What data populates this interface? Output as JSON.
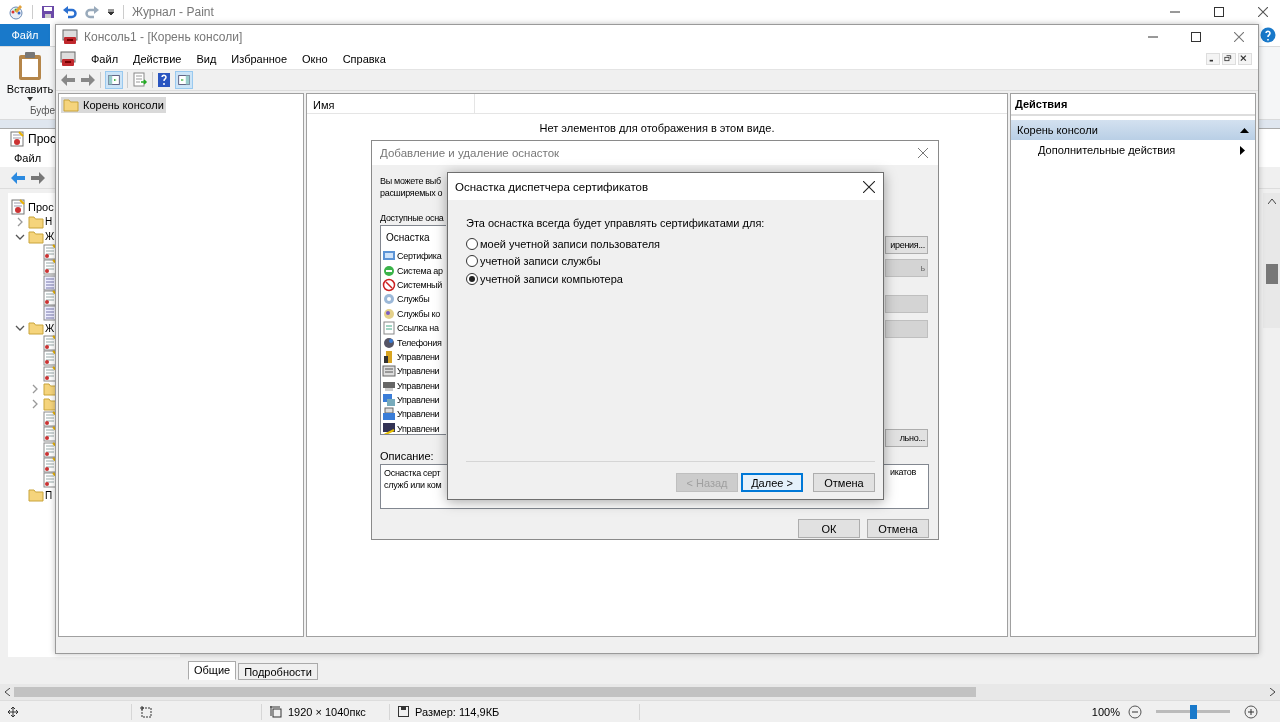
{
  "paint": {
    "title": "Журнал - Paint",
    "ribbon_tab": "Файл",
    "paste_label": "Вставить",
    "group_label": "Буфе",
    "status_bar": {
      "dimensions": "1920 × 1040пкс",
      "file_size": "Размер: 114,9КБ",
      "zoom": "100%",
      "zoom_slider": {
        "level": 0.5
      }
    }
  },
  "event_viewer": {
    "title": "Прос",
    "menu": [
      "Файл"
    ],
    "tree": [
      {
        "label": "Прос",
        "kind": "viewer",
        "children": [
          {
            "label": "Н",
            "kind": "folder",
            "expanded": false
          },
          {
            "label": "Ж",
            "kind": "folder",
            "expanded": true,
            "children": [
              {
                "kind": "log"
              },
              {
                "kind": "log"
              },
              {
                "kind": "list"
              },
              {
                "kind": "log"
              },
              {
                "kind": "list"
              }
            ]
          },
          {
            "label": "Ж",
            "kind": "folder",
            "expanded": true,
            "children": [
              {
                "kind": "log"
              },
              {
                "kind": "log"
              },
              {
                "kind": "log"
              },
              {
                "kind": "folder",
                "expanded": false
              },
              {
                "kind": "folder",
                "expanded": false
              },
              {
                "kind": "log"
              },
              {
                "kind": "log"
              },
              {
                "kind": "log"
              },
              {
                "kind": "log"
              },
              {
                "kind": "log"
              }
            ]
          },
          {
            "label": "П",
            "kind": "folder"
          }
        ]
      }
    ],
    "tabs": [
      {
        "label": "Общие",
        "selected": true
      },
      {
        "label": "Подробности",
        "selected": false
      }
    ]
  },
  "mmc": {
    "title": "Консоль1 - [Корень консоли]",
    "menu": [
      "Файл",
      "Действие",
      "Вид",
      "Избранное",
      "Окно",
      "Справка"
    ],
    "toolbar_toggles": {
      "console_tree": true,
      "action_pane": true
    },
    "tree": [
      {
        "label": "Корень консоли",
        "selected": true
      }
    ],
    "columns": [
      "Имя"
    ],
    "empty_message": "Нет элементов для отображения в этом виде.",
    "actions": {
      "title": "Действия",
      "groups": [
        {
          "label": "Корень консоли",
          "expanded": true,
          "items": [
            {
              "label": "Дополнительные действия",
              "submenu": true
            }
          ]
        }
      ]
    }
  },
  "add_dialog": {
    "title": "Добавление и удаление оснасток",
    "intro": [
      "Вы можете выб",
      "расширяемых о"
    ],
    "available_label": "Доступные осна",
    "list_header": "Оснастка",
    "snapins": [
      "Сертифика",
      "Система ар",
      "Системный",
      "Службы",
      "Службы ко",
      "Ссылка на",
      "Телефония",
      "Управлени",
      "Управлени",
      "Управлени",
      "Управлени",
      "Управлени",
      "Управлени"
    ],
    "side_buttons": [
      {
        "label": "ирения...",
        "disabled": false
      },
      {
        "label": "ь",
        "disabled": true
      },
      {
        "disabled": true
      },
      {
        "disabled": true
      },
      {
        "label": "льно...",
        "disabled": false
      }
    ],
    "description_label": "Описание:",
    "description_left": [
      "Оснастка серт",
      "служб или ком"
    ],
    "description_right": "икатов",
    "buttons": [
      {
        "label": "ОК"
      },
      {
        "label": "Отмена"
      }
    ]
  },
  "cert_dialog": {
    "title": "Оснастка диспетчера сертификатов",
    "prompt": "Эта оснастка всегда будет управлять сертификатами для:",
    "options": [
      {
        "label": "моей учетной записи пользователя",
        "selected": false
      },
      {
        "label": "учетной записи службы",
        "selected": false
      },
      {
        "label": "учетной записи компьютера",
        "selected": true
      }
    ],
    "buttons": [
      {
        "label": "< Назад",
        "disabled": true,
        "focused": false
      },
      {
        "label": "Далее >",
        "disabled": false,
        "focused": true
      },
      {
        "label": "Отмена",
        "disabled": false,
        "focused": false
      }
    ]
  }
}
